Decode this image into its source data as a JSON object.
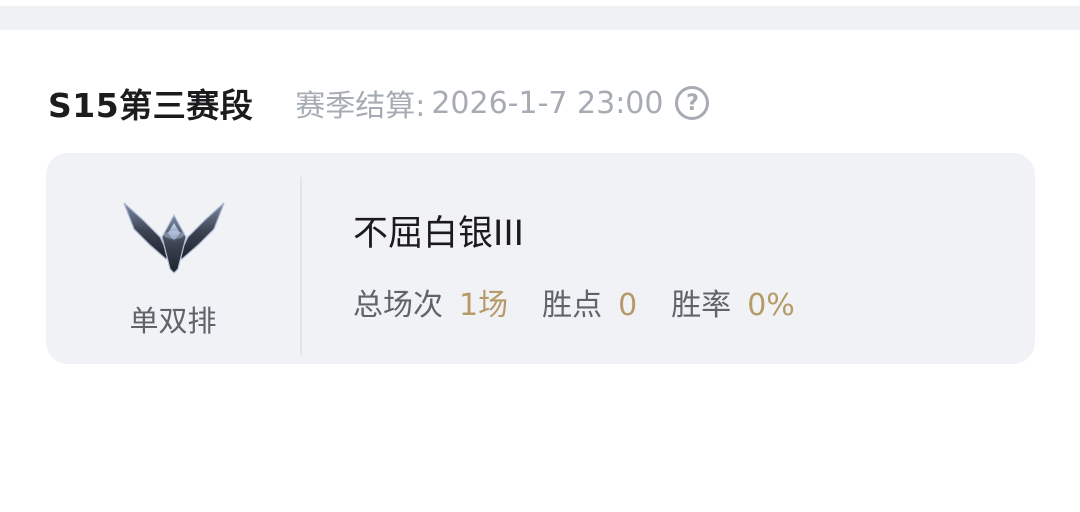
{
  "season": {
    "title": "S15第三赛段",
    "settlement_label": "赛季结算:",
    "settlement_time": "2026-1-7 23:00",
    "help_glyph": "?"
  },
  "rank_card": {
    "queue_label": "单双排",
    "emblem_icon": "silver-rank-emblem",
    "tier": "不屈白银III",
    "stats": [
      {
        "label": "总场次",
        "value": "1场"
      },
      {
        "label": "胜点",
        "value": "0"
      },
      {
        "label": "胜率",
        "value": "0%"
      }
    ]
  },
  "colors": {
    "accent_gold": "#b69a6a",
    "muted_text": "#a7acb4",
    "card_bg": "#f1f2f5"
  }
}
